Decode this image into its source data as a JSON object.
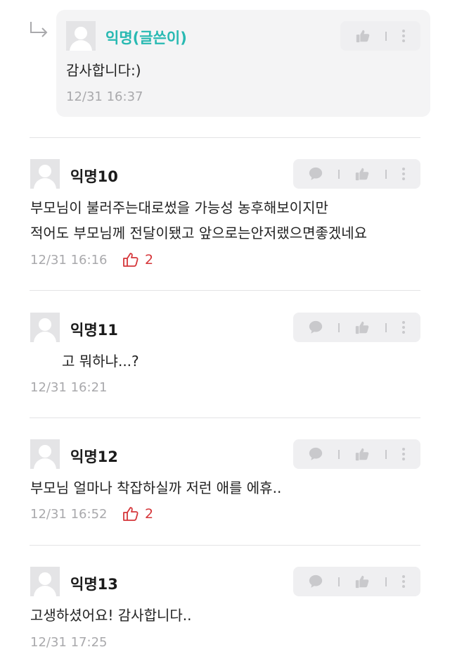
{
  "comments": [
    {
      "name": "익명(글쓴이)",
      "text": [
        "감사합니다:)"
      ],
      "time": "12/31 16:37",
      "likes": null,
      "is_author": true,
      "is_reply": true
    },
    {
      "name": "익명10",
      "text": [
        "부모님이 불러주는대로썼을 가능성 농후해보이지만",
        "적어도 부모님께 전달이됐고 앞으로는안저랬으면좋겠네요"
      ],
      "time": "12/31 16:16",
      "likes": "2"
    },
    {
      "name": "익명11",
      "text": [
        "고 뭐하냐...?"
      ],
      "time": "12/31 16:21",
      "likes": null
    },
    {
      "name": "익명12",
      "text": [
        "부모님 얼마나 착잡하실까 저런 애를 에휴.."
      ],
      "time": "12/31 16:52",
      "likes": "2"
    },
    {
      "name": "익명13",
      "text": [
        "고생하셨어요! 감사합니다.."
      ],
      "time": "12/31 17:25",
      "likes": null
    }
  ],
  "icons": {
    "reply": "reply-arrow-icon",
    "comment": "speech-bubble-icon",
    "like": "thumbs-up-icon",
    "more": "more-vertical-icon",
    "like_count": "thumbs-up-outline-icon"
  },
  "colors": {
    "author_name": "#28b9b2",
    "like_count": "#d5363a",
    "timestamp": "#a9a9ac",
    "reply_background": "#f4f4f5",
    "action_bar": "#efeff1"
  }
}
